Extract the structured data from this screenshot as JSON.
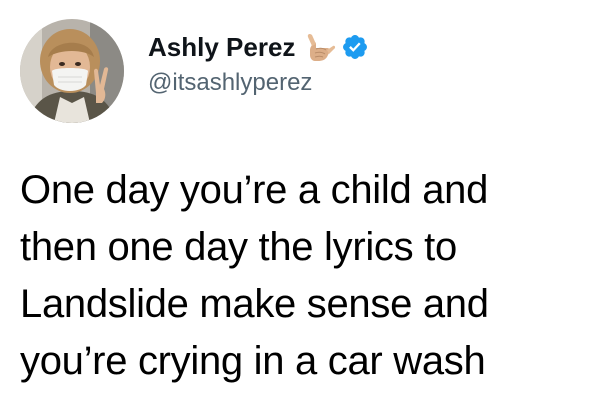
{
  "author": {
    "display_name": "Ashly Perez",
    "handle": "@itsashlyperez",
    "emoji_icon": "call-me-hand-emoji",
    "verified_icon": "verified-badge-icon",
    "verified_color": "#1d9bf0"
  },
  "tweet": {
    "lines": [
      "One day you’re a child and",
      "then one day the lyrics to",
      "Landslide make sense and",
      "you’re crying in a car wash"
    ]
  },
  "colors": {
    "text": "#000000",
    "handle": "#536471"
  }
}
